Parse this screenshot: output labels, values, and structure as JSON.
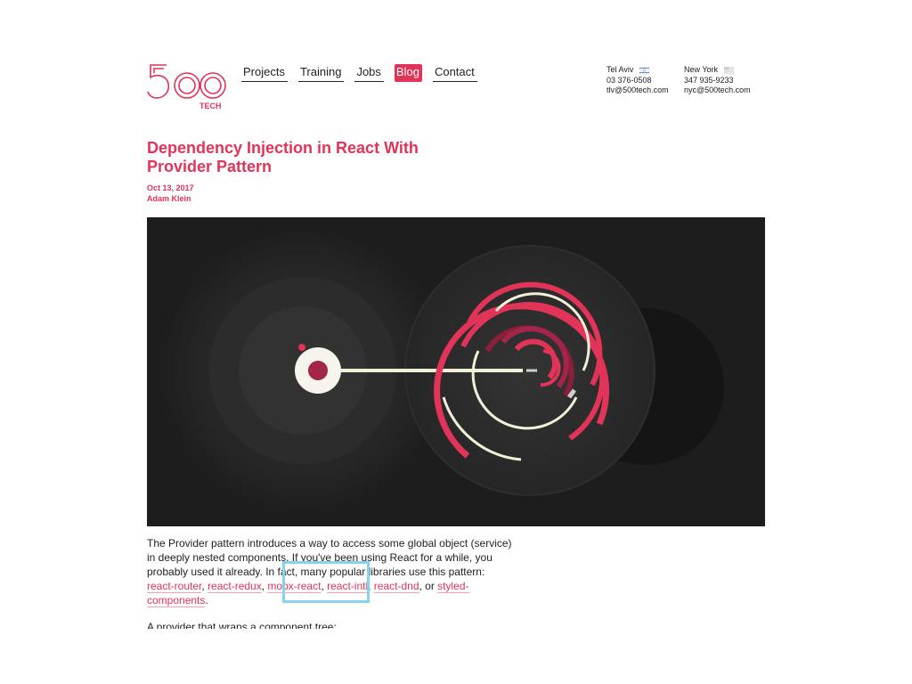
{
  "brand": {
    "logo_number": "500",
    "logo_word": "TECH",
    "accent": "#e23359"
  },
  "nav": {
    "items": [
      {
        "label": "Projects",
        "active": false
      },
      {
        "label": "Training",
        "active": false
      },
      {
        "label": "Jobs",
        "active": false
      },
      {
        "label": "Blog",
        "active": true
      },
      {
        "label": "Contact",
        "active": false
      }
    ]
  },
  "offices": {
    "tlv": {
      "city": "Tel Aviv",
      "phone": "03 376-0508",
      "email": "tlv@500tech.com",
      "flag_icon": "israel-flag-icon"
    },
    "nyc": {
      "city": "New York",
      "phone": "347 935-9233",
      "email": "nyc@500tech.com",
      "flag_icon": "usa-flag-icon"
    }
  },
  "article": {
    "title": "Dependency Injection in React With Provider Pattern",
    "date": "Oct 13, 2017",
    "author": "Adam Klein",
    "intro_1": "The Provider pattern introduces a way to access some global object (service) in deeply nested components. If you've been using React for a while, you probably used it already. In fact, many popular libraries use this pattern: ",
    "links": [
      "react-router",
      "react-redux",
      "mobx-react",
      "react-intl",
      "react-dnd",
      "styled-components"
    ],
    "sep_comma": ", ",
    "sep_or": ", or ",
    "end": ".",
    "next_line": "A provider that wraps a component tree:"
  },
  "hero": {
    "background": "#1d1d1d",
    "accent": "#e23359"
  }
}
